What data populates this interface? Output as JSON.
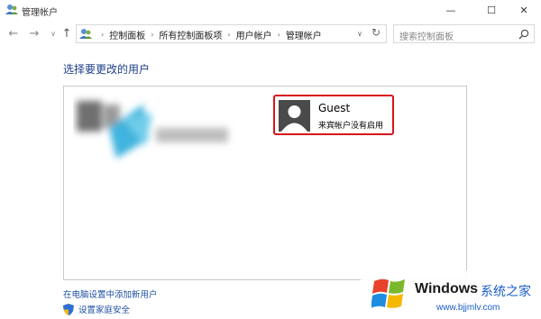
{
  "window": {
    "title": "管理帐户",
    "minimize_glyph": "—",
    "maximize_glyph": "☐",
    "close_glyph": "✕"
  },
  "nav": {
    "back_glyph": "←",
    "forward_glyph": "→",
    "recent_glyph": "∨",
    "up_glyph": "↑",
    "breadcrumbs": [
      "控制面板",
      "所有控制面板项",
      "用户帐户",
      "管理帐户"
    ],
    "crumb_separator": "›",
    "address_dropdown_glyph": "∨",
    "refresh_glyph": "↻",
    "search_placeholder": "搜索控制面板"
  },
  "main": {
    "heading": "选择要更改的用户",
    "guest": {
      "name": "Guest",
      "status": "来宾帐户没有启用"
    },
    "links": {
      "add_user": "在电脑设置中添加新用户",
      "family_safety": "设置家庭安全"
    }
  },
  "watermark": {
    "brand": "Windows",
    "site_name": "系统之家",
    "url": "www.bjjmlv.com"
  },
  "colors": {
    "link": "#1e50a2",
    "heading": "#1e3f8a",
    "highlight": "#d9141b"
  }
}
